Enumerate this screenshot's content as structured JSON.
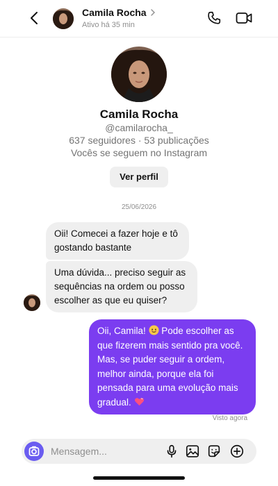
{
  "header": {
    "name": "Camila Rocha",
    "status": "Ativo há 35 min"
  },
  "profile": {
    "name": "Camila Rocha",
    "username": "@camilarocha_",
    "stats": "637 seguidores · 53 publicações",
    "follow_note": "Vocês se seguem no Instagram",
    "view_profile_label": "Ver perfil"
  },
  "chat": {
    "date": "25/06/2026",
    "incoming": [
      "Oii! Comecei a fazer hoje e tô gostando bastante",
      "Uma dúvida... preciso seguir as sequências na ordem ou posso escolher as que eu quiser?"
    ],
    "outgoing": {
      "part1": "Oii, Camila! ",
      "part2": " Pode escolher as que fizerem mais sentido pra você. Mas, se puder seguir a ordem, melhor ainda, porque ela foi pensada para uma evolução mais gradual. "
    },
    "seen": "Visto agora"
  },
  "composer": {
    "placeholder": "Mensagem..."
  },
  "colors": {
    "accent": "#7b3df0",
    "camera": "#6a5cf0",
    "bubble_in": "#efefef"
  },
  "icons": [
    "back-icon",
    "chevron-right-icon",
    "phone-icon",
    "video-icon",
    "camera-icon",
    "mic-icon",
    "image-icon",
    "sticker-icon",
    "plus-icon",
    "smile-emoji-icon",
    "heart-emoji-icon"
  ]
}
